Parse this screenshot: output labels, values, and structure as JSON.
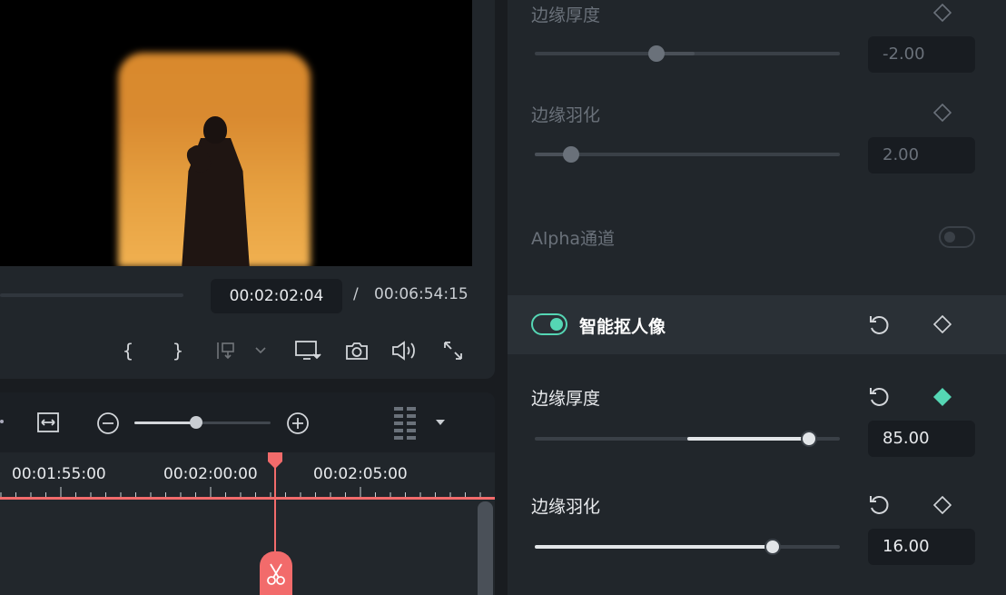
{
  "player": {
    "current_time": "00:02:02:04",
    "separator": "/",
    "total_time": "00:06:54:15",
    "progress": 0.29
  },
  "timeline": {
    "zoom_level": 0.45,
    "ruler_labels": [
      "00:01:55:00",
      "00:02:00:00",
      "00:02:05:00"
    ]
  },
  "properties": {
    "upper": {
      "edge_thickness": {
        "label": "边缘厚度",
        "value": "-2.00",
        "level": 0.4
      },
      "edge_feather": {
        "label": "边缘羽化",
        "value": "2.00",
        "level": 0.12
      },
      "alpha_channel": {
        "label": "Alpha通道",
        "enabled": false
      }
    },
    "smart_portrait": {
      "title": "智能抠人像",
      "enabled": true,
      "edge_thickness": {
        "label": "边缘厚度",
        "value": "85.00",
        "level": 0.9
      },
      "edge_feather": {
        "label": "边缘羽化",
        "value": "16.00",
        "level": 0.78
      }
    }
  },
  "colors": {
    "accent": "#55d6b4",
    "playhead": "#f26b6b",
    "panel": "#21262b",
    "background": "#191c20"
  }
}
